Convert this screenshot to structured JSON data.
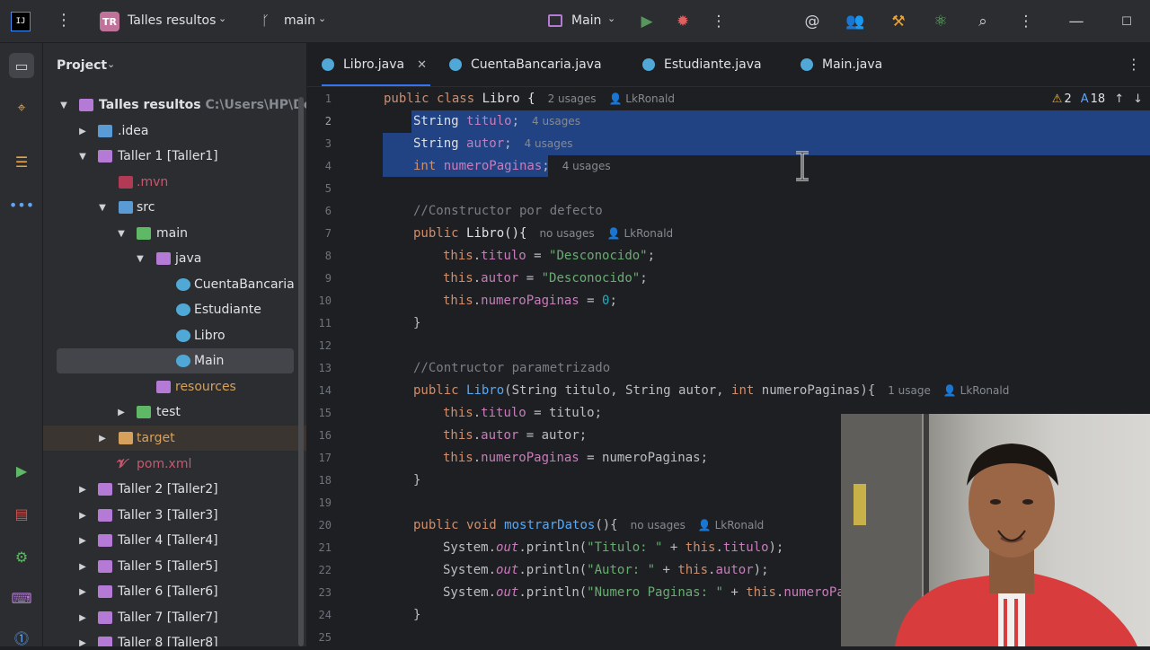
{
  "titlebar": {
    "project_badge": "TR",
    "project_name": "Talles resultos",
    "branch": "main",
    "run_config": "Main"
  },
  "project_panel": {
    "title": "Project",
    "tree": [
      {
        "label": "Talles resultos",
        "hint": "C:\\Users\\HP\\Docum"
      },
      {
        "label": ".idea"
      },
      {
        "label": "Taller 1 [Taller1]"
      },
      {
        "label": ".mvn"
      },
      {
        "label": "src"
      },
      {
        "label": "main"
      },
      {
        "label": "java"
      },
      {
        "label": "CuentaBancaria"
      },
      {
        "label": "Estudiante"
      },
      {
        "label": "Libro"
      },
      {
        "label": "Main"
      },
      {
        "label": "resources"
      },
      {
        "label": "test"
      },
      {
        "label": "target"
      },
      {
        "label": "pom.xml"
      },
      {
        "label": "Taller 2 [Taller2]"
      },
      {
        "label": "Taller 3 [Taller3]"
      },
      {
        "label": "Taller 4 [Taller4]"
      },
      {
        "label": "Taller 5 [Taller5]"
      },
      {
        "label": "Taller 6 [Taller6]"
      },
      {
        "label": "Taller 7 [Taller7]"
      },
      {
        "label": "Taller 8 [Taller8]"
      }
    ]
  },
  "tabs": [
    {
      "label": "Libro.java"
    },
    {
      "label": "CuentaBancaria.java"
    },
    {
      "label": "Estudiante.java"
    },
    {
      "label": "Main.java"
    }
  ],
  "editor": {
    "warnings": "2",
    "typos": "18",
    "line_numbers": [
      "1",
      "2",
      "3",
      "4",
      "5",
      "6",
      "7",
      "8",
      "9",
      "10",
      "11",
      "12",
      "13",
      "14",
      "15",
      "16",
      "17",
      "18",
      "19",
      "20",
      "21",
      "22",
      "23",
      "24",
      "25"
    ],
    "hints": {
      "l1": "2 usages",
      "l1_author": "LkRonald",
      "l2": "4 usages",
      "l3": "4 usages",
      "l4": "4 usages",
      "l7": "no usages",
      "l7_author": "LkRonald",
      "l14": "1 usage",
      "l14_author": "LkRonald",
      "l20": "no usages",
      "l20_author": "LkRonald"
    }
  }
}
